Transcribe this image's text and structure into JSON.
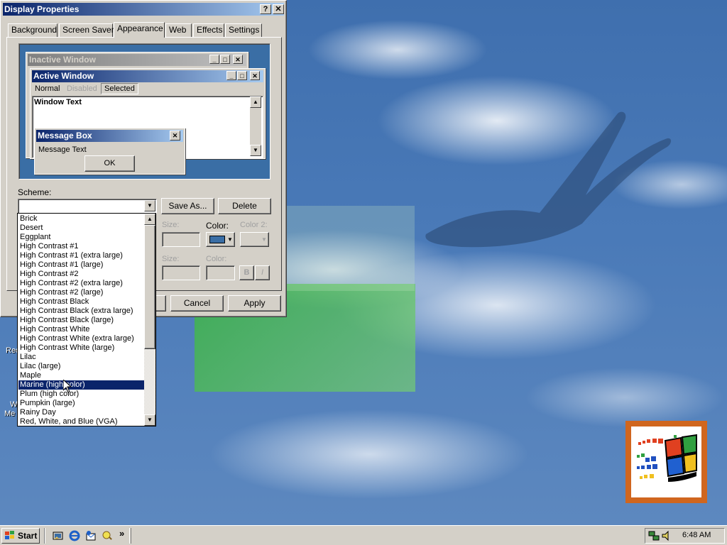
{
  "dialog": {
    "title": "Display Properties",
    "help_btn": "?",
    "close_btn": "✕",
    "tabs": [
      "Background",
      "Screen Saver",
      "Appearance",
      "Web",
      "Effects",
      "Settings"
    ],
    "active_tab": "Appearance"
  },
  "preview": {
    "inactive_title": "Inactive Window",
    "active_title": "Active Window",
    "menu_normal": "Normal",
    "menu_disabled": "Disabled",
    "menu_selected": "Selected",
    "window_text": "Window Text",
    "msgbox_title": "Message Box",
    "msgbox_text": "Message Text",
    "ok": "OK"
  },
  "controls": {
    "scheme_label": "Scheme:",
    "save_as": "Save As...",
    "delete": "Delete",
    "size_label": "Size:",
    "color_label": "Color:",
    "color2_label": "Color 2:",
    "size2_label": "Size:",
    "color3_label": "Color:",
    "bold_btn": "B",
    "italic_btn": "I",
    "accent_color": "#3a6ea5",
    "ok_fragment": "",
    "cancel": "Cancel",
    "apply": "Apply"
  },
  "scheme_options": [
    "Brick",
    "Desert",
    "Eggplant",
    "High Contrast #1",
    "High Contrast #1 (extra large)",
    "High Contrast #1 (large)",
    "High Contrast #2",
    "High Contrast #2 (extra large)",
    "High Contrast #2 (large)",
    "High Contrast Black",
    "High Contrast Black (extra large)",
    "High Contrast Black (large)",
    "High Contrast White",
    "High Contrast White (extra large)",
    "High Contrast White (large)",
    "Lilac",
    "Lilac (large)",
    "Maple",
    "Marine (high color)",
    "Plum (high color)",
    "Pumpkin (large)",
    "Rainy Day",
    "Red, White, and Blue (VGA)"
  ],
  "selected_scheme": "Marine (high color)",
  "desktop_labels": [
    "Rec",
    "W",
    "Me"
  ],
  "taskbar": {
    "start": "Start",
    "chevron": "»",
    "clock": "6:48 AM",
    "quicklaunch_icons": [
      "show-desktop-icon",
      "internet-explorer-icon",
      "outlook-express-icon",
      "windows-media-icon"
    ]
  }
}
